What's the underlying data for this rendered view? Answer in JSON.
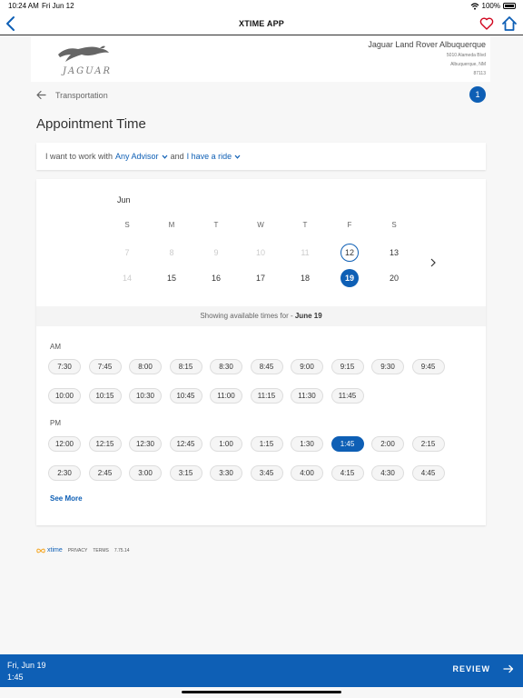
{
  "status_bar": {
    "time": "10:24 AM",
    "date": "Fri Jun 12",
    "battery": "100%"
  },
  "nav": {
    "title": "XTIME APP",
    "icons": [
      "chevron-left-icon",
      "heart-icon",
      "home-icon"
    ]
  },
  "dealer": {
    "brand": "JAGUAR",
    "name": "Jaguar Land Rover Albuquerque",
    "address": [
      "5010 Alameda Blvd",
      "Albuquerque, NM",
      "87113"
    ]
  },
  "breadcrumb": {
    "label": "Transportation",
    "step": "1"
  },
  "page_title": "Appointment Time",
  "advisor": {
    "prefix": "I want to work with",
    "advisor": "Any Advisor",
    "conjunction": "and",
    "ride": "I have a ride"
  },
  "calendar": {
    "month": "Jun",
    "weekdays": [
      "S",
      "M",
      "T",
      "W",
      "T",
      "F",
      "S"
    ],
    "weeks": [
      [
        {
          "day": "7",
          "state": "disabled"
        },
        {
          "day": "8",
          "state": "disabled"
        },
        {
          "day": "9",
          "state": "disabled"
        },
        {
          "day": "10",
          "state": "disabled"
        },
        {
          "day": "11",
          "state": "disabled"
        },
        {
          "day": "12",
          "state": "today"
        },
        {
          "day": "13",
          "state": "enabled"
        }
      ],
      [
        {
          "day": "14",
          "state": "disabled"
        },
        {
          "day": "15",
          "state": "enabled"
        },
        {
          "day": "16",
          "state": "enabled"
        },
        {
          "day": "17",
          "state": "enabled"
        },
        {
          "day": "18",
          "state": "enabled"
        },
        {
          "day": "19",
          "state": "selected"
        },
        {
          "day": "20",
          "state": "enabled"
        }
      ]
    ]
  },
  "showing": {
    "prefix": "Showing available times for -",
    "date": "June 19"
  },
  "am": {
    "label": "AM",
    "rows": [
      [
        "7:30",
        "7:45",
        "8:00",
        "8:15",
        "8:30",
        "8:45",
        "9:00",
        "9:15",
        "9:30",
        "9:45"
      ],
      [
        "10:00",
        "10:15",
        "10:30",
        "10:45",
        "11:00",
        "11:15",
        "11:30",
        "11:45"
      ]
    ]
  },
  "pm": {
    "label": "PM",
    "selected": "1:45",
    "rows": [
      [
        "12:00",
        "12:15",
        "12:30",
        "12:45",
        "1:00",
        "1:15",
        "1:30",
        "1:45",
        "2:00",
        "2:15"
      ],
      [
        "2:30",
        "2:45",
        "3:00",
        "3:15",
        "3:30",
        "3:45",
        "4:00",
        "4:15",
        "4:30",
        "4:45"
      ]
    ]
  },
  "see_more": "See More",
  "footer": {
    "brand": "xtime",
    "privacy": "PRIVACY",
    "terms": "TERMS",
    "version": "7.75.14"
  },
  "bottom": {
    "date": "Fri, Jun 19",
    "time": "1:45",
    "review": "REVIEW"
  },
  "colors": {
    "accent": "#0e5fb5",
    "heart": "#d0021b"
  }
}
